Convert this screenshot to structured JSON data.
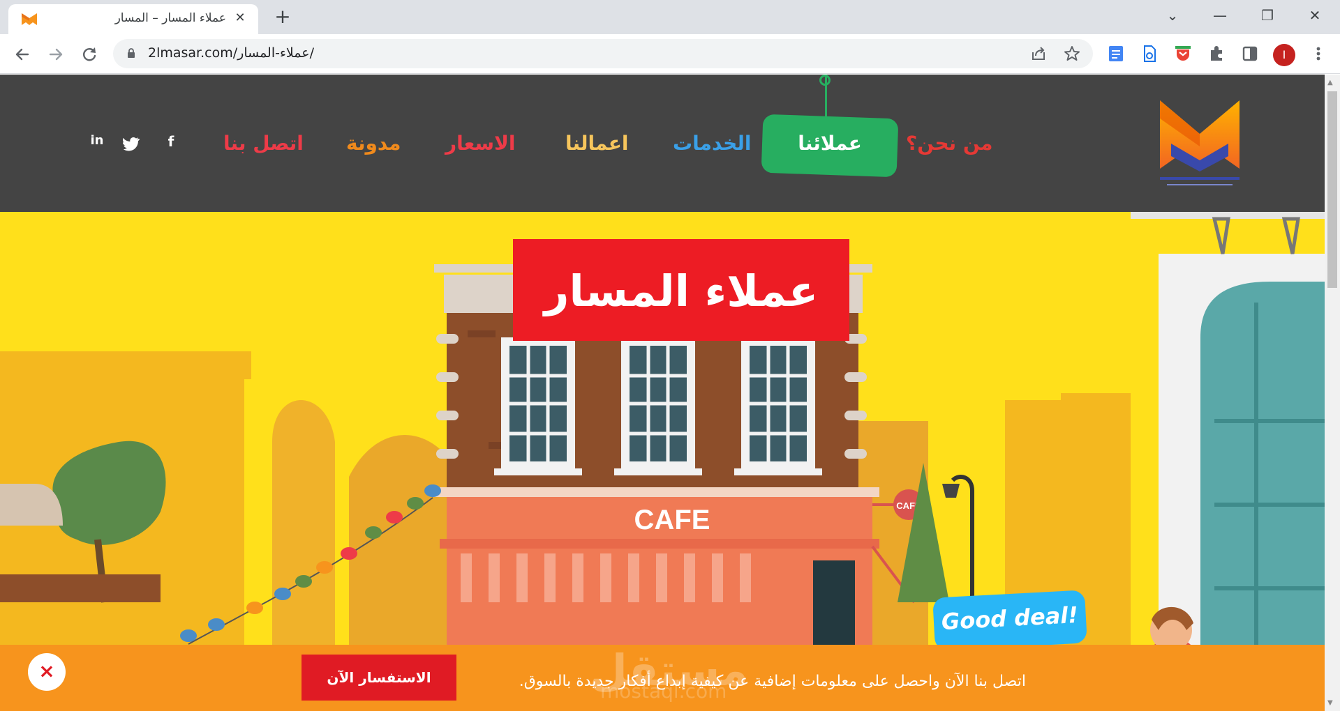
{
  "browser": {
    "tab_title": "عملاء المسار – المسار",
    "tab_close": "✕",
    "new_tab": "+",
    "url": "2lmasar.com/عملاء-المسار/",
    "window_buttons": {
      "dropdown": "⌄",
      "minimize": "—",
      "restore": "❐",
      "close": "✕"
    },
    "profile_initial": "I"
  },
  "site": {
    "menu": {
      "about": "من نحن؟",
      "clients": "عملائنا",
      "services": "الخدمات",
      "works": "اعمالنا",
      "prices": "الاسعار",
      "blog": "مدونة",
      "contact": "اتصل بنا"
    },
    "social": {
      "facebook": "f",
      "twitter": "🐦",
      "linkedin": "in"
    },
    "hero": {
      "title": "عملاء المسار",
      "cafe_sign": "CAFE",
      "cafe_small_sign": "CAFE",
      "speech_bubble": "Good deal!"
    },
    "cta": {
      "text": "اتصل بنا الآن واحصل على معلومات إضافية عن كيفية إبداع أفكار جديدة بالسوق.",
      "button": "الاستفسار الآن",
      "close": "×"
    },
    "watermark": {
      "main": "مستقل",
      "sub": "mostaql.com"
    }
  },
  "colors": {
    "header_bg": "#444444",
    "hero_bg": "#ffe01b",
    "active_menu": "#27ae60",
    "title_box": "#ed1c24",
    "cta_bar": "#f7941d",
    "cta_button": "#e01b24",
    "menu_about": "#e53935",
    "menu_services": "#3aa0e8",
    "menu_works": "#f6c55c",
    "menu_prices": "#ee3b48",
    "menu_blog": "#f08a1c",
    "menu_contact": "#ee3b48"
  },
  "icons": {
    "back": "arrow-left-icon",
    "forward": "arrow-right-icon",
    "reload": "reload-icon",
    "lock": "lock-icon",
    "share": "share-icon",
    "star": "star-icon",
    "extensions": "puzzle-icon",
    "sidepanel": "sidepanel-icon"
  }
}
